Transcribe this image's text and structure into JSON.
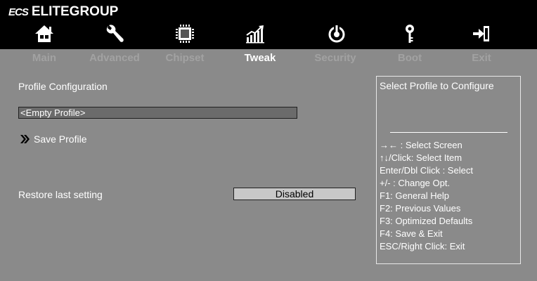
{
  "brand": {
    "logo": "ECS",
    "name": "ELITEGROUP"
  },
  "nav_icons": [
    "home-icon",
    "wrench-icon",
    "chip-icon",
    "chart-icon",
    "power-icon",
    "key-icon",
    "exit-icon"
  ],
  "tabs": [
    {
      "label": "Main",
      "active": false
    },
    {
      "label": "Advanced",
      "active": false
    },
    {
      "label": "Chipset",
      "active": false
    },
    {
      "label": "Tweak",
      "active": true
    },
    {
      "label": "Security",
      "active": false
    },
    {
      "label": "Boot",
      "active": false
    },
    {
      "label": "Exit",
      "active": false
    }
  ],
  "main": {
    "section_title": "Profile Configuration",
    "profile_field_value": "<Empty Profile>",
    "save_profile_label": "Save Profile",
    "restore_label": "Restore last setting",
    "restore_value": "Disabled"
  },
  "help": {
    "title": "Select Profile to Configure",
    "items": [
      "→←  : Select Screen",
      "↑↓/Click: Select Item",
      "Enter/Dbl Click : Select",
      "+/- : Change Opt.",
      "F1: General Help",
      "F2: Previous Values",
      "F3: Optimized Defaults",
      "F4: Save & Exit",
      "ESC/Right Click: Exit"
    ]
  },
  "colors": {
    "background": "#8a8a8a",
    "header": "#000000",
    "inactive_tab": "#a2a2a2",
    "active_tab": "#ffffff",
    "value_box": "#c8c8c8"
  }
}
